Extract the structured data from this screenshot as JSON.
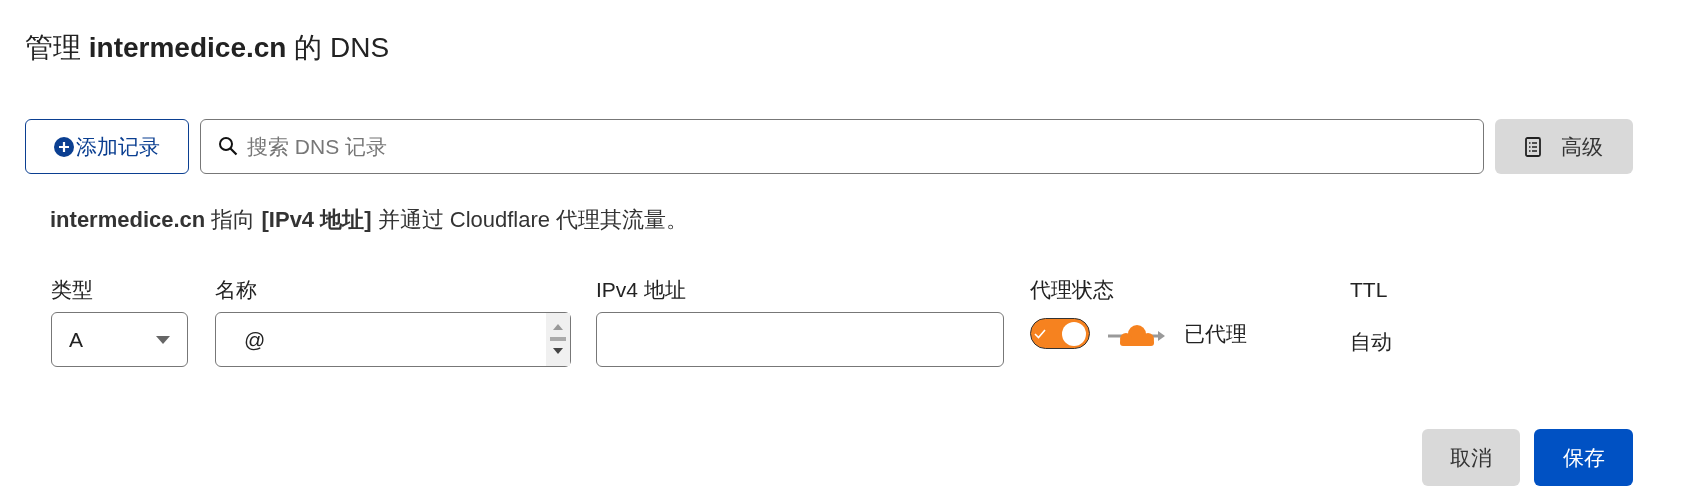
{
  "title": "管理 **intermedice.cn** 的 DNS",
  "toolbar": {
    "add_button": "添加记录",
    "search": {
      "placeholder": "搜索 DNS 记录"
    },
    "advanced_button": "高级"
  },
  "description": "**intermedice.cn** 指向 **[IPv4 地址]** 并通过 Cloudflare 代理其流量。",
  "form": {
    "type": {
      "label": "类型",
      "value": "A"
    },
    "name": {
      "label": "名称",
      "value": "@"
    },
    "ipv4": {
      "label": "IPv4 地址"
    },
    "proxy": {
      "label": "代理状态",
      "on": true,
      "status": "已代理"
    },
    "ttl": {
      "label": "TTL",
      "value": "自动"
    }
  },
  "buttons": {
    "cancel": "取消",
    "save": "保存"
  }
}
